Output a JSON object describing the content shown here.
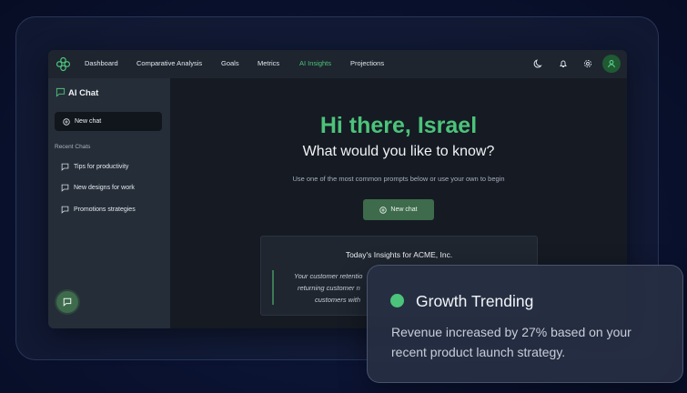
{
  "nav": {
    "items": [
      "Dashboard",
      "Comparative Analysis",
      "Goals",
      "Metrics",
      "AI Insights",
      "Projections"
    ],
    "active": "AI Insights"
  },
  "sidebar": {
    "title": "AI Chat",
    "new_chat": "New chat",
    "recent_label": "Recent Chats",
    "recent": [
      "Tips for productivity",
      "New designs for work",
      "Promotions strategies"
    ]
  },
  "main": {
    "greeting": "Hi there, Israel",
    "subtitle": "What would you like to know?",
    "hint": "Use one of the most common prompts below or use your own to begin",
    "new_chat": "New chat",
    "insights": {
      "title": "Today's Insights for ACME, Inc.",
      "lines": [
        "Your customer retentio",
        "returning customer n",
        "customers with"
      ]
    }
  },
  "overlay": {
    "title": "Growth Trending",
    "line1": "Revenue increased by 27% based on your",
    "line2": "recent product launch strategy."
  },
  "colors": {
    "accent": "#4cc37a",
    "button": "#3d6b4b"
  }
}
